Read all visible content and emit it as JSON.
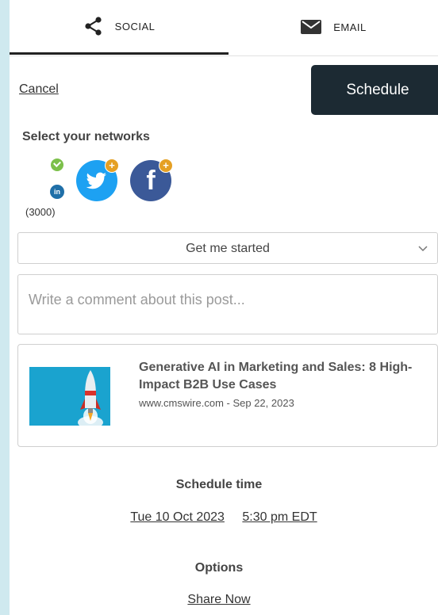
{
  "tabs": {
    "social_label": "SOCIAL",
    "email_label": "EMAIL"
  },
  "actions": {
    "cancel_label": "Cancel",
    "schedule_label": "Schedule"
  },
  "networks": {
    "label": "Select your networks",
    "linkedin": {
      "badge": "in",
      "count": "(3000)",
      "selected": true
    },
    "twitter": {
      "selected": false
    },
    "facebook": {
      "glyph": "f",
      "selected": false
    },
    "add_glyph": "+"
  },
  "dropdown": {
    "selected": "Get me started"
  },
  "comment": {
    "placeholder": "Write a comment about this post...",
    "value": ""
  },
  "article": {
    "title": "Generative AI in Marketing and Sales: 8 High-Impact B2B Use Cases",
    "meta": "www.cmswire.com - Sep 22, 2023"
  },
  "schedule": {
    "label": "Schedule time",
    "date": "Tue 10 Oct 2023",
    "time": "5:30 pm EDT"
  },
  "options": {
    "label": "Options",
    "share_now": "Share Now"
  },
  "colors": {
    "background": "#cfe9ef",
    "schedule_button": "#1c2a33",
    "twitter": "#1da1f2",
    "facebook": "#3b5998",
    "linkedin": "#1f6fa8",
    "check": "#7cc04a",
    "add_badge": "#e5a024",
    "thumbnail": "#1aa3cf"
  }
}
